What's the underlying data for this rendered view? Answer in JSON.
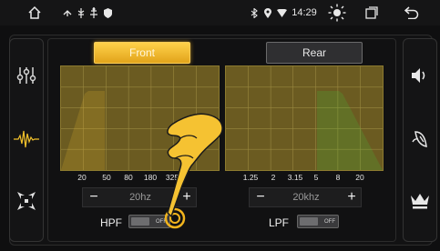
{
  "status_bar": {
    "home_icon": "home-icon",
    "time": "14:29",
    "icons": [
      "usb-icon",
      "usb-icon",
      "usb-icon",
      "shield-icon",
      "bluetooth-icon",
      "location-icon",
      "wifi-icon"
    ]
  },
  "left_sidebar": {
    "items": [
      {
        "icon": "equalizer-sliders-icon"
      },
      {
        "icon": "waveform-icon"
      },
      {
        "icon": "balance-arrows-icon"
      }
    ]
  },
  "right_sidebar": {
    "items": [
      {
        "icon": "speaker-icon"
      },
      {
        "icon": "sound-effect-icon"
      },
      {
        "icon": "crown-icon"
      }
    ]
  },
  "tabs": [
    {
      "label": "Front",
      "active": true
    },
    {
      "label": "Rear",
      "active": false
    }
  ],
  "hpf": {
    "ticks": [
      "20",
      "50",
      "80",
      "180",
      "325"
    ],
    "value": "20hz",
    "label": "HPF",
    "switch_state": "OFF",
    "plateau_from_tick": 1,
    "color": "#f2c12b"
  },
  "lpf": {
    "ticks": [
      "1.25",
      "2",
      "3.15",
      "5",
      "8",
      "20"
    ],
    "value": "20khz",
    "label": "LPF",
    "switch_state": "OFF",
    "plateau_to_tick": 4,
    "color": "#3bd23b"
  },
  "buttons": {
    "minus": "−",
    "plus": "+"
  },
  "colors": {
    "accent": "#f2c12b",
    "graph_bg": "#6b5b21",
    "lpf_curve": "#3bd23b"
  }
}
